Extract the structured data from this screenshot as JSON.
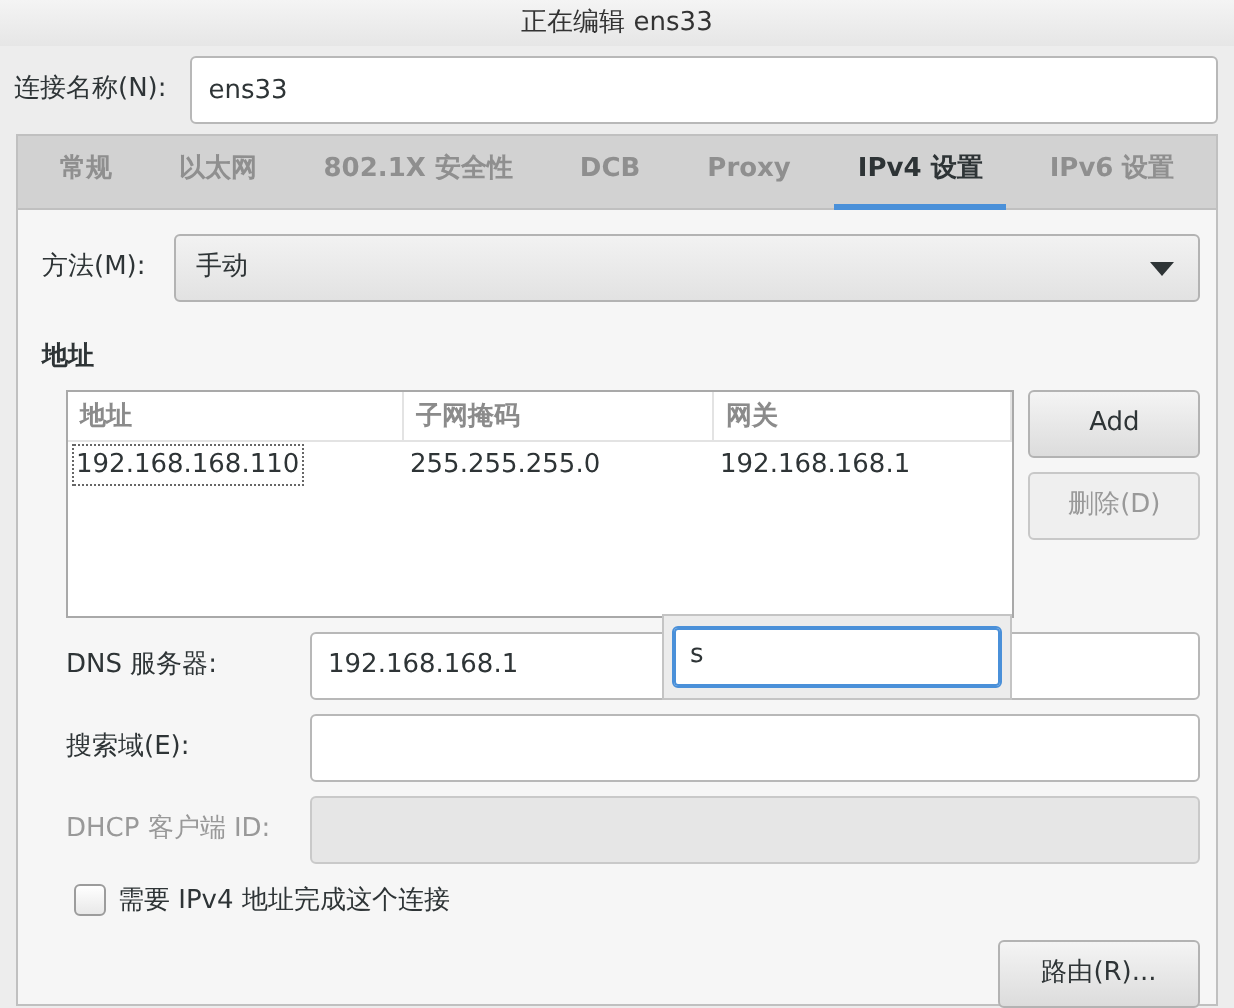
{
  "window": {
    "title": "正在编辑 ens33"
  },
  "connection_name": {
    "label": "连接名称(N):",
    "value": "ens33"
  },
  "tabs": [
    {
      "label": "常规",
      "selected": false
    },
    {
      "label": "以太网",
      "selected": false
    },
    {
      "label": "802.1X 安全性",
      "selected": false
    },
    {
      "label": "DCB",
      "selected": false
    },
    {
      "label": "Proxy",
      "selected": false
    },
    {
      "label": "IPv4 设置",
      "selected": true
    },
    {
      "label": "IPv6 设置",
      "selected": false
    }
  ],
  "method": {
    "label": "方法(M):",
    "value": "手动"
  },
  "addresses": {
    "heading": "地址",
    "columns": [
      "地址",
      "子网掩码",
      "网关"
    ],
    "rows": [
      [
        "192.168.168.110",
        "255.255.255.0",
        "192.168.168.1"
      ]
    ],
    "buttons": [
      {
        "label": "Add",
        "disabled": false
      },
      {
        "label": "删除(D)",
        "disabled": true
      }
    ]
  },
  "fields": [
    {
      "label": "DNS 服务器:",
      "value": "192.168.168.1",
      "disabled": false
    },
    {
      "label": "搜索域(E):",
      "disabled": false
    },
    {
      "label": "DHCP 客户端 ID:",
      "disabled": true
    }
  ],
  "edit_popup": {
    "value": "s"
  },
  "require_ipv4": {
    "label": "需要 IPv4 地址完成这个连接",
    "checked": false
  },
  "routes_button": {
    "label": "路由(R)..."
  }
}
